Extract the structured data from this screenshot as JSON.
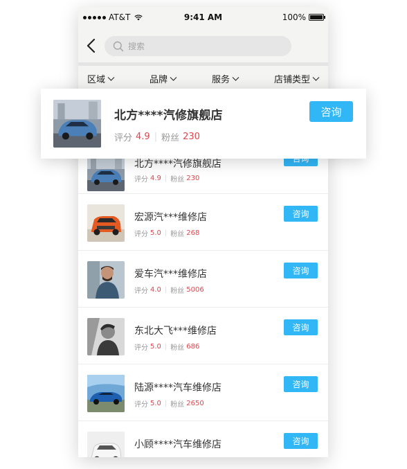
{
  "status_bar": {
    "carrier": "AT&T",
    "time": "9:41 AM",
    "battery_text": "100%",
    "battery_level": 1.0
  },
  "search": {
    "placeholder": "搜索",
    "icon": "search-icon"
  },
  "filters": [
    {
      "label": "区域"
    },
    {
      "label": "品牌"
    },
    {
      "label": "服务"
    },
    {
      "label": "店铺类型"
    }
  ],
  "featured_shop": {
    "name": "北方****汽修旗舰店",
    "rating_label": "评分",
    "rating": "4.9",
    "fans_label": "粉丝",
    "fans": "230",
    "button": "咨询"
  },
  "shops": [
    {
      "name": "北方****汽修旗舰店",
      "rating_label": "评分",
      "rating": "4.9",
      "fans_label": "粉丝",
      "fans": "230",
      "button": "咨询",
      "thumb": "blue-sedan"
    },
    {
      "name": "宏源汽***维修店",
      "rating_label": "评分",
      "rating": "5.0",
      "fans_label": "粉丝",
      "fans": "268",
      "button": "咨询",
      "thumb": "orange-suv"
    },
    {
      "name": "爱车汽***维修店",
      "rating_label": "评分",
      "rating": "4.0",
      "fans_label": "粉丝",
      "fans": "5006",
      "button": "咨询",
      "thumb": "man-portrait"
    },
    {
      "name": "东北大飞***维修店",
      "rating_label": "评分",
      "rating": "5.0",
      "fans_label": "粉丝",
      "fans": "686",
      "button": "咨询",
      "thumb": "bw-portrait"
    },
    {
      "name": "陆源****汽车维修店",
      "rating_label": "评分",
      "rating": "5.0",
      "fans_label": "粉丝",
      "fans": "2650",
      "button": "咨询",
      "thumb": "blue-sportscar"
    },
    {
      "name": "小顾****汽车维修店",
      "rating_label": "评分",
      "rating": "",
      "fans_label": "",
      "fans": "",
      "button": "咨询",
      "thumb": "white-car"
    }
  ],
  "colors": {
    "accent": "#31b6f6",
    "number": "#e0454d",
    "bar_bg": "#f4f4f2"
  }
}
